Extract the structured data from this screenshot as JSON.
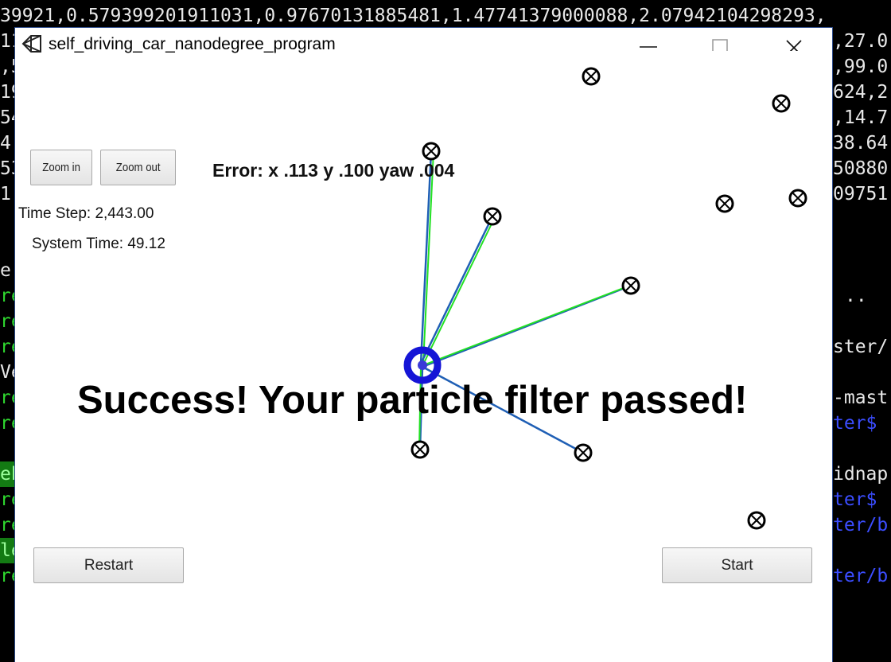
{
  "terminal": {
    "line_top": "39921,0.579399201911031,0.97670131885481,1.47741379000088,2.07942104298293,",
    "left_fragments": [
      "11",
      ",5",
      "19",
      "54",
      "4,",
      "53",
      "1.",
      "",
      "",
      "e",
      "re",
      "re",
      "re",
      "Ve",
      "re",
      "re",
      "",
      "eb",
      "re",
      "re",
      "le",
      "re"
    ],
    "right_fragments": [
      ",27.0",
      ",99.0",
      "624,2",
      ",14.7",
      "38.64",
      "50880",
      "09751",
      "",
      "",
      "",
      "..",
      "",
      "ster/",
      "",
      "-mast",
      "ter$",
      "",
      "idnap",
      "ter$",
      "ter/b",
      "",
      "ter/b"
    ]
  },
  "window": {
    "title": "self_driving_car_nanodegree_program"
  },
  "sim": {
    "zoom_in_label": "Zoom in",
    "zoom_out_label": "Zoom out",
    "error_text": "Error: x .113 y .100 yaw .004",
    "time_step_text": "Time Step: 2,443.00",
    "system_time_text": "System Time: 49.12",
    "success_text": "Success! Your particle filter passed!",
    "restart_label": "Restart",
    "start_label": "Start"
  },
  "colors": {
    "vehicle": "#1515d6",
    "observation_line": "#1f5fb5",
    "prediction_line": "#22e122",
    "landmark": "#000000"
  }
}
